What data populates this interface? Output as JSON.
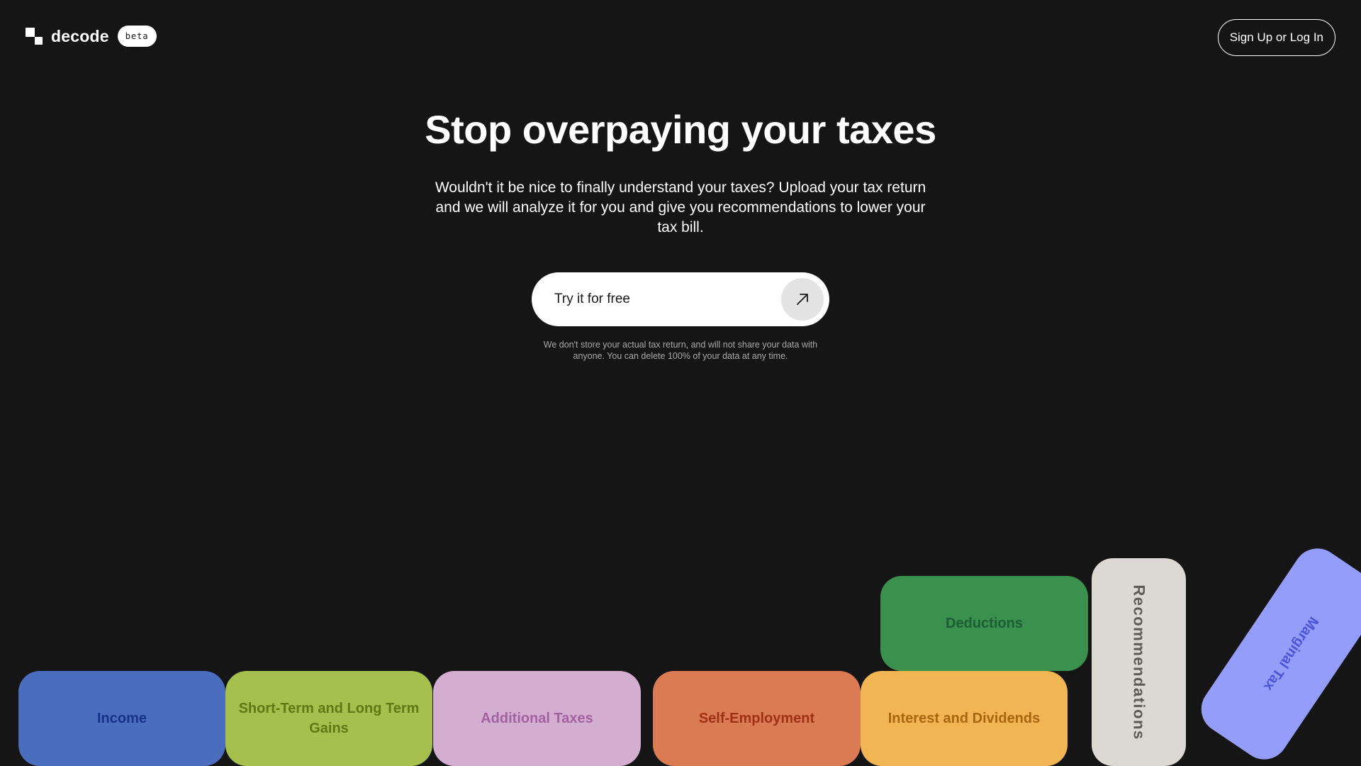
{
  "header": {
    "brand_name": "decode",
    "badge": "beta",
    "auth_button": "Sign Up or Log In"
  },
  "hero": {
    "title": "Stop overpaying your taxes",
    "subtitle": "Wouldn't it be nice to finally understand your taxes? Upload your tax return and we will analyze it for you and give you recommendations to lower your tax bill.",
    "cta_label": "Try it for free",
    "cta_icon": "arrow-up-right-icon",
    "privacy_note": "We don't store your actual tax return, and will not share your data with anyone. You can delete 100% of your data at any time."
  },
  "categories": [
    {
      "label": "Income",
      "color": "#4a6ebd"
    },
    {
      "label": "Short-Term and Long Term Gains",
      "color": "#a6c04d"
    },
    {
      "label": "Additional Taxes",
      "color": "#d3aed0"
    },
    {
      "label": "Self-Employment",
      "color": "#db7b53"
    },
    {
      "label": "Interest and Dividends",
      "color": "#f2b553"
    },
    {
      "label": "Deductions",
      "color": "#3a914d"
    },
    {
      "label": "Recommendations",
      "color": "#dcd8d4"
    },
    {
      "label": "Marginal Tax",
      "color": "#959dfa"
    }
  ],
  "theme": {
    "background": "#151515",
    "text": "#ffffff"
  }
}
